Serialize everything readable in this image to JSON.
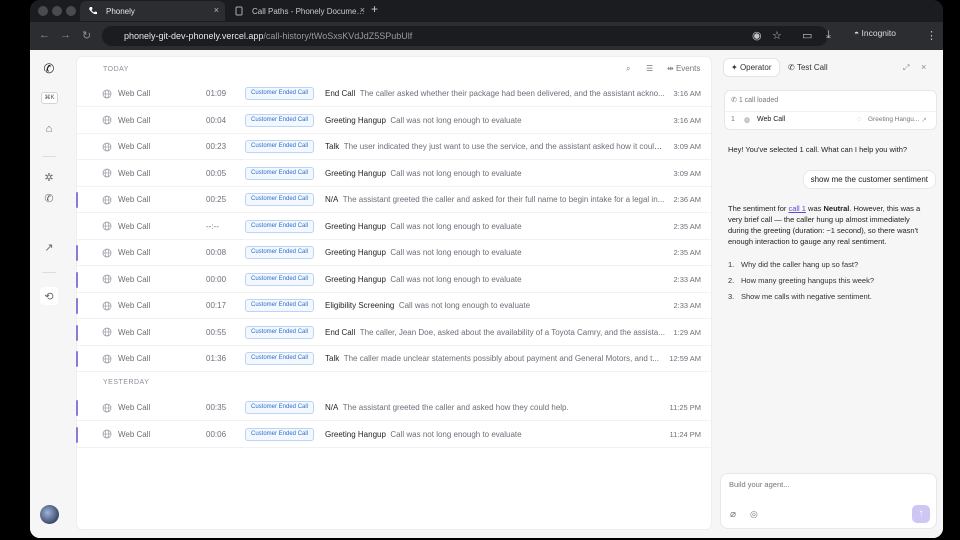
{
  "browser": {
    "tabs": [
      {
        "title": "Phonely",
        "active": true
      },
      {
        "title": "Call Paths - Phonely Docume…",
        "active": false
      }
    ],
    "url_host": "phonely-git-dev-phonely.vercel.app",
    "url_path": "/call-history/tWoSxsKVdJdZ5SPubUlf",
    "incognito_label": "Incognito"
  },
  "sidebar": {
    "shortcut": "⌘K"
  },
  "call_list": {
    "today_label": "TODAY",
    "yesterday_label": "YESTERDAY",
    "events_label": "Events",
    "today_rows": [
      {
        "type": "Web Call",
        "duration": "01:09",
        "badge": "Customer Ended Call",
        "node": "End Call",
        "summary": "The caller asked whether their package had been delivered, and the assistant ackno...",
        "time": "3:16 AM",
        "marked": false
      },
      {
        "type": "Web Call",
        "duration": "00:04",
        "badge": "Customer Ended Call",
        "node": "Greeting Hangup",
        "summary": "Call was not long enough to evaluate",
        "time": "3:16 AM",
        "marked": false
      },
      {
        "type": "Web Call",
        "duration": "00:23",
        "badge": "Customer Ended Call",
        "node": "Talk",
        "summary": "The user indicated they just want to use the service, and the assistant asked how it could...",
        "time": "3:09 AM",
        "marked": false
      },
      {
        "type": "Web Call",
        "duration": "00:05",
        "badge": "Customer Ended Call",
        "node": "Greeting Hangup",
        "summary": "Call was not long enough to evaluate",
        "time": "3:09 AM",
        "marked": false
      },
      {
        "type": "Web Call",
        "duration": "00:25",
        "badge": "Customer Ended Call",
        "node": "N/A",
        "summary": "The assistant greeted the caller and asked for their full name to begin intake for a legal in...",
        "time": "2:36 AM",
        "marked": true
      },
      {
        "type": "Web Call",
        "duration": "--:--",
        "badge": "Customer Ended Call",
        "node": "Greeting Hangup",
        "summary": "Call was not long enough to evaluate",
        "time": "2:35 AM",
        "marked": false
      },
      {
        "type": "Web Call",
        "duration": "00:08",
        "badge": "Customer Ended Call",
        "node": "Greeting Hangup",
        "summary": "Call was not long enough to evaluate",
        "time": "2:35 AM",
        "marked": true
      },
      {
        "type": "Web Call",
        "duration": "00:00",
        "badge": "Customer Ended Call",
        "node": "Greeting Hangup",
        "summary": "Call was not long enough to evaluate",
        "time": "2:33 AM",
        "marked": true
      },
      {
        "type": "Web Call",
        "duration": "00:17",
        "badge": "Customer Ended Call",
        "node": "Eligibility Screening",
        "summary": "Call was not long enough to evaluate",
        "time": "2:33 AM",
        "marked": true
      },
      {
        "type": "Web Call",
        "duration": "00:55",
        "badge": "Customer Ended Call",
        "node": "End Call",
        "summary": "The caller, Jean Doe, asked about the availability of a Toyota Camry, and the assista...",
        "time": "1:29 AM",
        "marked": true
      },
      {
        "type": "Web Call",
        "duration": "01:36",
        "badge": "Customer Ended Call",
        "node": "Talk",
        "summary": "The caller made unclear statements possibly about payment and General Motors, and t...",
        "time": "12:59 AM",
        "marked": true
      }
    ],
    "yesterday_rows": [
      {
        "type": "Web Call",
        "duration": "00:35",
        "badge": "Customer Ended Call",
        "node": "N/A",
        "summary": "The assistant greeted the caller and asked how they could help.",
        "time": "11:25 PM",
        "marked": true
      },
      {
        "type": "Web Call",
        "duration": "00:06",
        "badge": "Customer Ended Call",
        "node": "Greeting Hangup",
        "summary": "Call was not long enough to evaluate",
        "time": "11:24 PM",
        "marked": true
      }
    ]
  },
  "panel": {
    "tab_operator": "Operator",
    "tab_test_call": "Test Call",
    "card_title": "1 call loaded",
    "card_row_num": "1",
    "card_row_type": "Web Call",
    "card_row_status": "Greeting Hangu...",
    "assistant_msg_1": "Hey! You've selected 1 call. What can I help you with?",
    "user_msg": "show me the customer sentiment",
    "sentiment_p1": "The sentiment for ",
    "sentiment_link": "call 1",
    "sentiment_p2": " was ",
    "sentiment_bold": "Neutral",
    "sentiment_p3": ". However, this was a very brief call — the caller hung up almost immediately during the greeting (duration: ~1 second), so there wasn't enough interaction to gauge any real sentiment.",
    "suggestions": [
      "Why did the caller hang up so fast?",
      "How many greeting hangups this week?",
      "Show me calls with negative sentiment."
    ],
    "composer_placeholder": "Build your agent..."
  },
  "colors": {
    "accent": "#8b7bd8",
    "badge_text": "#2f6fcb"
  }
}
